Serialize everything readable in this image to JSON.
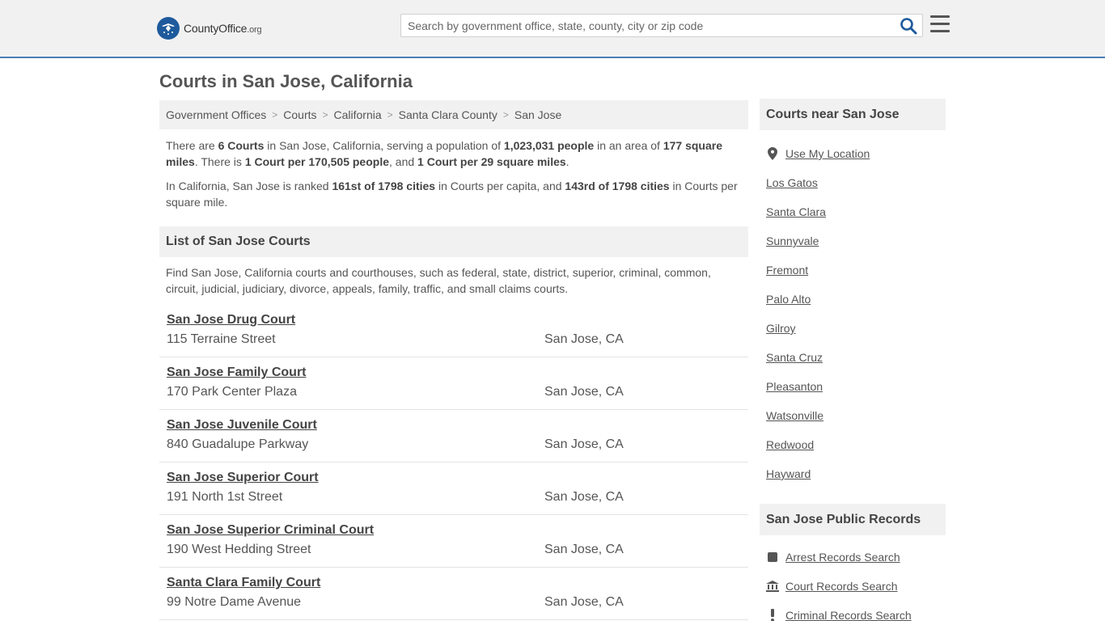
{
  "header": {
    "logo_main": "CountyOffice",
    "logo_org": ".org",
    "search_placeholder": "Search by government office, state, county, city or zip code"
  },
  "page_title": "Courts in San Jose, California",
  "breadcrumb": [
    "Government Offices",
    "Courts",
    "California",
    "Santa Clara County",
    "San Jose"
  ],
  "intro": {
    "p1": {
      "t1": "There are ",
      "b1": "6 Courts",
      "t2": " in San Jose, California, serving a population of ",
      "b2": "1,023,031 people",
      "t3": " in an area of ",
      "b3": "177 square miles",
      "t4": ". There is ",
      "b4": "1 Court per 170,505 people",
      "t5": ", and ",
      "b5": "1 Court per 29 square miles",
      "t6": "."
    },
    "p2": {
      "t1": "In California, San Jose is ranked ",
      "b1": "161st of 1798 cities",
      "t2": " in Courts per capita, and ",
      "b2": "143rd of 1798 cities",
      "t3": " in Courts per square mile."
    }
  },
  "list_section": {
    "title": "List of San Jose Courts",
    "description": "Find San Jose, California courts and courthouses, such as federal, state, district, superior, criminal, common, circuit, judicial, judiciary, divorce, appeals, family, traffic, and small claims courts."
  },
  "courts": [
    {
      "name": "San Jose Drug Court",
      "address": "115 Terraine Street",
      "city": "San Jose, CA"
    },
    {
      "name": "San Jose Family Court",
      "address": "170 Park Center Plaza",
      "city": "San Jose, CA"
    },
    {
      "name": "San Jose Juvenile Court",
      "address": "840 Guadalupe Parkway",
      "city": "San Jose, CA"
    },
    {
      "name": "San Jose Superior Court",
      "address": "191 North 1st Street",
      "city": "San Jose, CA"
    },
    {
      "name": "San Jose Superior Criminal Court",
      "address": "190 West Hedding Street",
      "city": "San Jose, CA"
    },
    {
      "name": "Santa Clara Family Court",
      "address": "99 Notre Dame Avenue",
      "city": "San Jose, CA"
    }
  ],
  "sidebar": {
    "nearby_title": "Courts near San Jose",
    "use_location": "Use My Location",
    "nearby": [
      "Los Gatos",
      "Santa Clara",
      "Sunnyvale",
      "Fremont",
      "Palo Alto",
      "Gilroy",
      "Santa Cruz",
      "Pleasanton",
      "Watsonville",
      "Redwood",
      "Hayward"
    ],
    "records_title": "San Jose Public Records",
    "records": [
      {
        "label": "Arrest Records Search",
        "icon": "arrest-icon"
      },
      {
        "label": "Court Records Search",
        "icon": "courthouse-icon"
      },
      {
        "label": "Criminal Records Search",
        "icon": "exclamation-icon"
      }
    ]
  },
  "colors": {
    "accent": "#4a7eb5",
    "logo_blue": "#1e5a9c",
    "panel_bg": "#f1f1f2"
  }
}
